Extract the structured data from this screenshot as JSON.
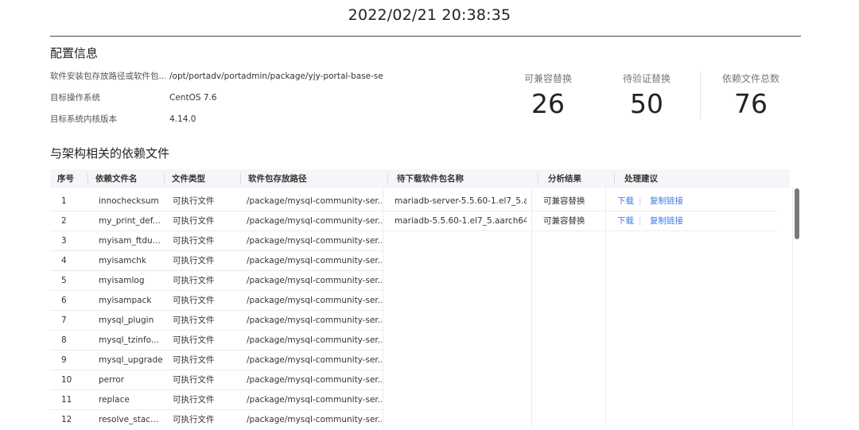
{
  "header": {
    "datetime": "2022/02/21 20:38:35"
  },
  "config": {
    "title": "配置信息",
    "rows": [
      {
        "label": "软件安装包存放路径或软件包...",
        "value": "/opt/portadv/portadmin/package/yjy-portal-base-se..."
      },
      {
        "label": "目标操作系统",
        "value": "CentOS 7.6"
      },
      {
        "label": "目标系统内核版本",
        "value": "4.14.0"
      }
    ]
  },
  "stats": [
    {
      "label": "可兼容替换",
      "value": "26"
    },
    {
      "label": "待验证替换",
      "value": "50"
    },
    {
      "label": "依赖文件总数",
      "value": "76"
    }
  ],
  "table": {
    "title": "与架构相关的依赖文件",
    "headers": [
      "序号",
      "依赖文件名",
      "文件类型",
      "软件包存放路径",
      "待下载软件包名称",
      "分析结果",
      "处理建议"
    ],
    "left_rows": [
      {
        "no": "1",
        "name": "innochecksum",
        "type": "可执行文件",
        "path": "/package/mysql-community-ser..."
      },
      {
        "no": "2",
        "name": "my_print_def...",
        "type": "可执行文件",
        "path": "/package/mysql-community-ser..."
      },
      {
        "no": "3",
        "name": "myisam_ftdu...",
        "type": "可执行文件",
        "path": "/package/mysql-community-ser..."
      },
      {
        "no": "4",
        "name": "myisamchk",
        "type": "可执行文件",
        "path": "/package/mysql-community-ser..."
      },
      {
        "no": "5",
        "name": "myisamlog",
        "type": "可执行文件",
        "path": "/package/mysql-community-ser..."
      },
      {
        "no": "6",
        "name": "myisampack",
        "type": "可执行文件",
        "path": "/package/mysql-community-ser..."
      },
      {
        "no": "7",
        "name": "mysql_plugin",
        "type": "可执行文件",
        "path": "/package/mysql-community-ser..."
      },
      {
        "no": "8",
        "name": "mysql_tzinfo...",
        "type": "可执行文件",
        "path": "/package/mysql-community-ser..."
      },
      {
        "no": "9",
        "name": "mysql_upgrade",
        "type": "可执行文件",
        "path": "/package/mysql-community-ser..."
      },
      {
        "no": "10",
        "name": "perror",
        "type": "可执行文件",
        "path": "/package/mysql-community-ser..."
      },
      {
        "no": "11",
        "name": "replace",
        "type": "可执行文件",
        "path": "/package/mysql-community-ser..."
      },
      {
        "no": "12",
        "name": "resolve_stac...",
        "type": "可执行文件",
        "path": "/package/mysql-community-ser..."
      }
    ],
    "right_rows": [
      {
        "pkg": "mariadb-server-5.5.60-1.el7_5.a...",
        "result": "可兼容替换",
        "download": "下载",
        "copy": "复制链接"
      },
      {
        "pkg": "mariadb-5.5.60-1.el7_5.aarch64....",
        "result": "可兼容替换",
        "download": "下载",
        "copy": "复制链接"
      }
    ],
    "link_color": "#3a7bf0"
  }
}
